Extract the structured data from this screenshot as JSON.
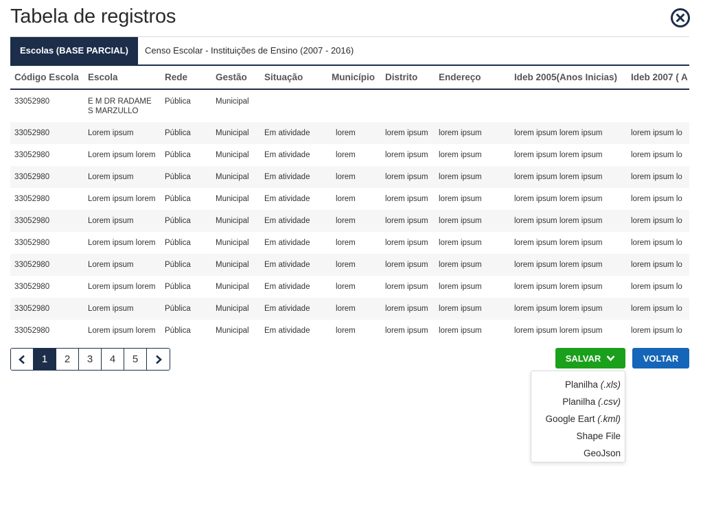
{
  "header": {
    "title": "Tabela de registros",
    "close_icon": "close-circle-icon"
  },
  "tabs": [
    {
      "label": "Escolas (BASE PARCIAL)",
      "active": true
    },
    {
      "label": "Censo Escolar - Instituições de Ensino (2007 - 2016)",
      "active": false
    }
  ],
  "table": {
    "columns": [
      "Código Escola",
      "Escola",
      "Rede",
      "Gestão",
      "Situação",
      "Município",
      "Distrito",
      "Endereço",
      "Ideb 2005(Anos Inicias)",
      "Ideb 2007 ( A"
    ],
    "rows": [
      [
        "33052980",
        "E M DR RADAME S MARZULLO",
        "Pública",
        "Municipal",
        "",
        "",
        "",
        "",
        "",
        ""
      ],
      [
        "33052980",
        "Lorem ipsum",
        "Pública",
        "Municipal",
        "Em atividade",
        "lorem",
        "lorem ipsum",
        "lorem ipsum",
        "lorem ipsum lorem ipsum",
        "lorem ipsum lo"
      ],
      [
        "33052980",
        "Lorem ipsum lorem",
        "Pública",
        "Municipal",
        "Em atividade",
        "lorem",
        "lorem ipsum",
        "lorem ipsum",
        "lorem ipsum lorem ipsum",
        "lorem ipsum lo"
      ],
      [
        "33052980",
        "Lorem ipsum",
        "Pública",
        "Municipal",
        "Em atividade",
        "lorem",
        "lorem ipsum",
        "lorem ipsum",
        "lorem ipsum lorem ipsum",
        "lorem ipsum lo"
      ],
      [
        "33052980",
        "Lorem ipsum lorem",
        "Pública",
        "Municipal",
        "Em atividade",
        "lorem",
        "lorem ipsum",
        "lorem ipsum",
        "lorem ipsum lorem ipsum",
        "lorem ipsum lo"
      ],
      [
        "33052980",
        "Lorem ipsum",
        "Pública",
        "Municipal",
        "Em atividade",
        "lorem",
        "lorem ipsum",
        "lorem ipsum",
        "lorem ipsum lorem ipsum",
        "lorem ipsum lo"
      ],
      [
        "33052980",
        "Lorem ipsum lorem",
        "Pública",
        "Municipal",
        "Em atividade",
        "lorem",
        "lorem ipsum",
        "lorem ipsum",
        "lorem ipsum lorem ipsum",
        "lorem ipsum lo"
      ],
      [
        "33052980",
        "Lorem ipsum",
        "Pública",
        "Municipal",
        "Em atividade",
        "lorem",
        "lorem ipsum",
        "lorem ipsum",
        "lorem ipsum lorem ipsum",
        "lorem ipsum lo"
      ],
      [
        "33052980",
        "Lorem ipsum lorem",
        "Pública",
        "Municipal",
        "Em atividade",
        "lorem",
        "lorem ipsum",
        "lorem ipsum",
        "lorem ipsum lorem ipsum",
        "lorem ipsum lo"
      ],
      [
        "33052980",
        "Lorem ipsum",
        "Pública",
        "Municipal",
        "Em atividade",
        "lorem",
        "lorem ipsum",
        "lorem ipsum",
        "lorem ipsum lorem ipsum",
        "lorem ipsum lo"
      ],
      [
        "33052980",
        "Lorem ipsum lorem",
        "Pública",
        "Municipal",
        "Em atividade",
        "lorem",
        "lorem ipsum",
        "lorem ipsum",
        "lorem ipsum lorem ipsum",
        "lorem ipsum lo"
      ]
    ]
  },
  "pagination": {
    "prev_icon": "chevron-left-icon",
    "next_icon": "chevron-right-icon",
    "pages": [
      "1",
      "2",
      "3",
      "4",
      "5"
    ],
    "current": "1"
  },
  "actions": {
    "save_label": "SALVAR",
    "save_icon": "chevron-down-icon",
    "back_label": "VOLTAR",
    "save_menu": [
      {
        "label": "Planilha",
        "suffix": "(.xls)"
      },
      {
        "label": "Planilha",
        "suffix": "(.csv)"
      },
      {
        "label": "Google Eart",
        "suffix": "(.kml)"
      },
      {
        "label": "Shape File",
        "suffix": ""
      },
      {
        "label": "GeoJson",
        "suffix": ""
      }
    ]
  },
  "colors": {
    "navy": "#1c2e4a",
    "save_green": "#1aa01a",
    "back_blue": "#1565b8",
    "row_stripe": "#f6f6f6"
  }
}
